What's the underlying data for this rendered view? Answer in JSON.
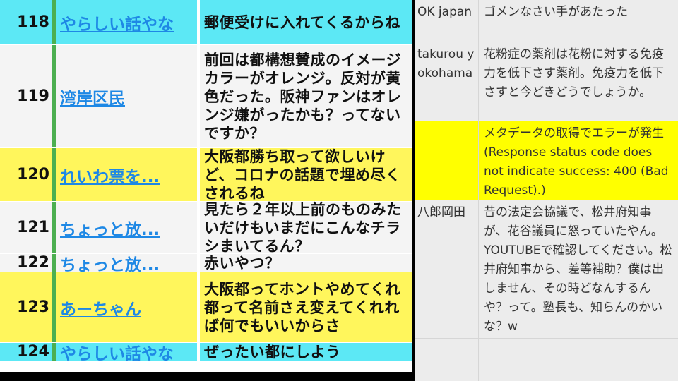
{
  "left_comments": [
    {
      "num": "118",
      "name": "やらしい話やな",
      "message": "郵便受けに入れてくるからね",
      "bg": "cyan"
    },
    {
      "num": "119",
      "name": "湾岸区民",
      "message": "前回は都構想賛成のイメージカラーがオレンジ。反対が黄色だった。阪神ファンはオレンジ嫌がったかも？ってないですか？",
      "bg": "white"
    },
    {
      "num": "120",
      "name": "れいわ票を...",
      "message": "大阪都勝ち取って欲しいけど、コロナの話題で埋め尽くされるね",
      "bg": "yellow"
    },
    {
      "num": "121",
      "name": "ちょっと放...",
      "message": "見たら２年以上前のものみたいだけもいまだにこんなチラシまいてるん？",
      "bg": "white"
    },
    {
      "num": "122",
      "name": "ちょっと放...",
      "message": "赤いやつ？",
      "bg": "white"
    },
    {
      "num": "123",
      "name": "あーちゃん",
      "message": "大阪都ってホントやめてくれ都って名前さえ変えてくれれば何でもいいからさ",
      "bg": "yellow"
    },
    {
      "num": "124",
      "name": "やらしい話やな",
      "message": "ぜったい都にしよう",
      "bg": "cyan"
    }
  ],
  "right_comments": [
    {
      "name": "OK japan",
      "message": "ゴメンなさい手があたった",
      "error": false
    },
    {
      "name": "takurou yokohama",
      "message": "花粉症の薬剤は花粉に対する免疫力を低下さす薬剤。免疫力を低下さすと今どきどうでしょうか。",
      "error": false
    },
    {
      "name": "",
      "message": "メタデータの取得でエラーが発生 (Response status code does not indicate success: 400 (Bad Request).)",
      "error": true
    },
    {
      "name": "八郎岡田",
      "message": "昔の法定会協議で、松井府知事が、花谷議員に怒っていたやん。YOUTUBEで確認してください。松井府知事から、差等補助？僕は出しません、その時どなんするんや？って。塾長も、知らんのかいな？w",
      "error": false
    }
  ],
  "colors": {
    "cyan": "#5ce8f5",
    "yellow": "#fff65c",
    "white": "#f4f4f4",
    "error_yellow": "#ffff00",
    "link_blue": "#1e88e5",
    "accent_green": "#4caf50"
  }
}
